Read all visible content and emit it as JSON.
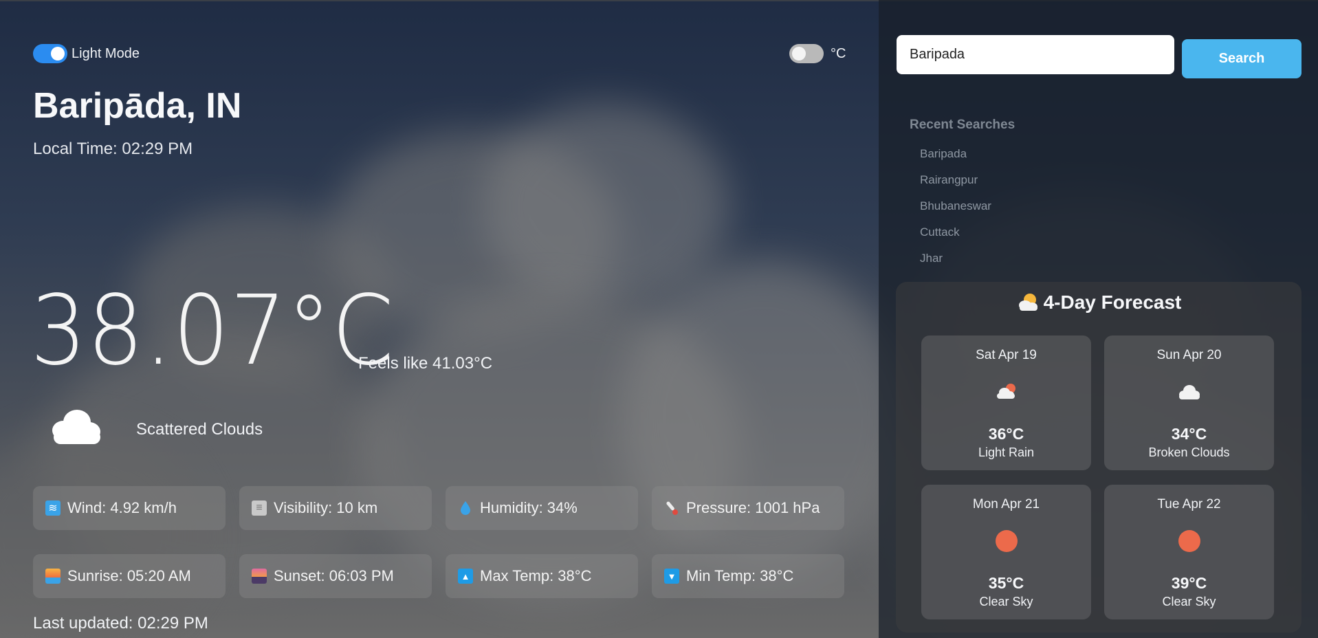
{
  "colors": {
    "toggle_on": "#2b8cf0",
    "search_button": "#4ab6ee",
    "sun": "#ec6a4b"
  },
  "header": {
    "theme_toggle_label": "Light Mode",
    "unit_toggle_label": "°C"
  },
  "current": {
    "city": "Baripāda, IN",
    "local_time": "Local Time: 02:29 PM",
    "temperature": "38.07°C",
    "feels_like": "Feels like 41.03°C",
    "condition": "Scattered Clouds",
    "condition_icon": "cloud-icon",
    "last_updated": "Last updated: 02:29 PM"
  },
  "stats": [
    {
      "icon": "wind-icon",
      "label": "Wind: 4.92 km/h"
    },
    {
      "icon": "fog-icon",
      "label": "Visibility: 10 km"
    },
    {
      "icon": "droplet-icon",
      "label": "Humidity: 34%"
    },
    {
      "icon": "thermometer-icon",
      "label": "Pressure: 1001 hPa"
    },
    {
      "icon": "sunrise-icon",
      "label": "Sunrise: 05:20 AM"
    },
    {
      "icon": "sunset-icon",
      "label": "Sunset: 06:03 PM"
    },
    {
      "icon": "up-triangle-icon",
      "label": "Max Temp: 38°C"
    },
    {
      "icon": "down-triangle-icon",
      "label": "Min Temp: 38°C"
    }
  ],
  "search": {
    "value": "Baripada",
    "button_label": "Search"
  },
  "recent": {
    "title": "Recent Searches",
    "items": [
      "Baripada",
      "Rairangpur",
      "Bhubaneswar",
      "Cuttack",
      "Jhar"
    ]
  },
  "forecast": {
    "title": "4-Day Forecast",
    "title_icon": "sun-behind-cloud-icon",
    "days": [
      {
        "date": "Sat Apr 19",
        "icon": "rain-cloud-icon",
        "temp": "36°C",
        "desc": "Light Rain"
      },
      {
        "date": "Sun Apr 20",
        "icon": "cloud-icon",
        "temp": "34°C",
        "desc": "Broken Clouds"
      },
      {
        "date": "Mon Apr 21",
        "icon": "sun-icon",
        "temp": "35°C",
        "desc": "Clear Sky"
      },
      {
        "date": "Tue Apr 22",
        "icon": "sun-icon",
        "temp": "39°C",
        "desc": "Clear Sky"
      }
    ]
  }
}
